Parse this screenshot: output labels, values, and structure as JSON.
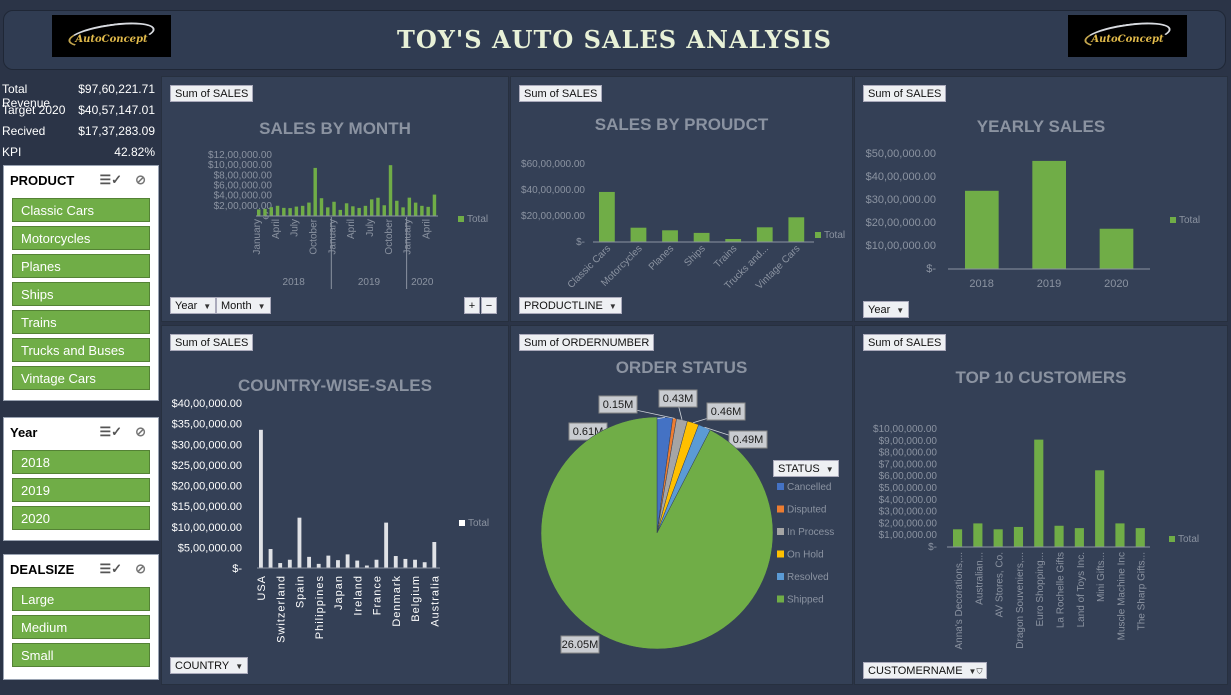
{
  "header": {
    "title": "TOY'S AUTO SALES ANALYSIS",
    "logo_text": "AutoConcept"
  },
  "kpis": [
    {
      "label": "Total Revenue",
      "value": "$97,60,221.71"
    },
    {
      "label": "Target 2020",
      "value": "$40,57,147.01"
    },
    {
      "label": "Recived",
      "value": "$17,37,283.09"
    },
    {
      "label": "KPI",
      "value": "42.82%"
    }
  ],
  "slicers": {
    "product": {
      "title": "PRODUCT",
      "items": [
        "Classic Cars",
        "Motorcycles",
        "Planes",
        "Ships",
        "Trains",
        "Trucks and Buses",
        "Vintage Cars"
      ]
    },
    "year": {
      "title": "Year",
      "items": [
        "2018",
        "2019",
        "2020"
      ]
    },
    "dealsize": {
      "title": "DEALSIZE",
      "items": [
        "Large",
        "Medium",
        "Small"
      ]
    }
  },
  "panels": {
    "month": {
      "value_field": "Sum of SALES",
      "title": "SALES BY MONTH",
      "year_button": "Year",
      "month_button": "Month"
    },
    "product": {
      "value_field": "Sum of SALES",
      "title": "SALES BY PROUDCT",
      "field_button": "PRODUCTLINE"
    },
    "yearly": {
      "value_field": "Sum of SALES",
      "title": "YEARLY SALES",
      "field_button": "Year"
    },
    "country": {
      "value_field": "Sum of SALES",
      "title": "COUNTRY-WISE-SALES",
      "field_button": "COUNTRY"
    },
    "status": {
      "value_field": "Sum of ORDERNUMBER",
      "title": "ORDER STATUS",
      "legend_title": "STATUS"
    },
    "customers": {
      "value_field": "Sum of SALES",
      "title": "TOP 10 CUSTOMERS",
      "field_button": "CUSTOMERNAME"
    }
  },
  "chart_data": [
    {
      "type": "bar",
      "title": "SALES BY MONTH",
      "legend": [
        "Total"
      ],
      "yticks": [
        "$-",
        "$2,00,000.00",
        "$4,00,000.00",
        "$6,00,000.00",
        "$8,00,000.00",
        "$10,00,000.00",
        "$12,00,000.00"
      ],
      "ylim": [
        0,
        1200000
      ],
      "month_labels": [
        "January",
        "April",
        "July",
        "October",
        "January",
        "April",
        "July",
        "October",
        "January",
        "April"
      ],
      "year_groups": [
        {
          "label": "2018",
          "months": 12
        },
        {
          "label": "2019",
          "months": 12
        },
        {
          "label": "2020",
          "months": 5
        }
      ],
      "series": [
        {
          "name": "Total",
          "values": [
            129000,
            140000,
            174000,
            201000,
            160000,
            155000,
            185000,
            200000,
            264000,
            946000,
            350000,
            170000,
            280000,
            120000,
            250000,
            191000,
            159000,
            200000,
            327000,
            359000,
            211000,
            1000000,
            300000,
            170000,
            361000,
            263000,
            200000,
            180000,
            421000
          ]
        }
      ],
      "color": "#70ad47"
    },
    {
      "type": "bar",
      "title": "SALES BY PROUDCT",
      "legend": [
        "Total"
      ],
      "yticks": [
        "$-",
        "$20,00,000.00",
        "$40,00,000.00",
        "$60,00,000.00"
      ],
      "ylim": [
        0,
        6000000
      ],
      "categories": [
        "Classic Cars",
        "Motorcycles",
        "Planes",
        "Ships",
        "Trains",
        "Trucks and...",
        "Vintage Cars"
      ],
      "values": [
        3850000,
        1100000,
        900000,
        700000,
        230000,
        1130000,
        1900000
      ],
      "color": "#70ad47"
    },
    {
      "type": "bar",
      "title": "YEARLY SALES",
      "legend": [
        "Total"
      ],
      "yticks": [
        "$-",
        "$10,00,000.00",
        "$20,00,000.00",
        "$30,00,000.00",
        "$40,00,000.00",
        "$50,00,000.00"
      ],
      "ylim": [
        0,
        5000000
      ],
      "categories": [
        "2018",
        "2019",
        "2020"
      ],
      "values": [
        3400000,
        4700000,
        1750000
      ],
      "color": "#70ad47"
    },
    {
      "type": "bar",
      "title": "COUNTRY-WISE-SALES",
      "legend": [
        "Total"
      ],
      "yticks": [
        "$-",
        "$5,00,000.00",
        "$10,00,000.00",
        "$15,00,000.00",
        "$20,00,000.00",
        "$25,00,000.00",
        "$30,00,000.00",
        "$35,00,000.00",
        "$40,00,000.00"
      ],
      "ylim": [
        0,
        4000000
      ],
      "categories": [
        "USA",
        "",
        "Switzerland",
        "",
        "Spain",
        "",
        "Philippines",
        "",
        "Japan",
        "",
        "Ireland",
        "",
        "France",
        "",
        "Denmark",
        "",
        "Belgium",
        "",
        "Australia"
      ],
      "values": [
        3350000,
        460000,
        120000,
        200000,
        1220000,
        270000,
        100000,
        300000,
        190000,
        330000,
        180000,
        60000,
        200000,
        1100000,
        290000,
        220000,
        200000,
        140000,
        630000
      ],
      "color": "#ffffff"
    },
    {
      "type": "pie",
      "title": "ORDER STATUS",
      "legend_title": "STATUS",
      "slices": [
        {
          "label": "Cancelled",
          "value": 0.61,
          "display": "0.61M",
          "color": "#4472c4"
        },
        {
          "label": "Disputed",
          "value": 0.15,
          "display": "0.15M",
          "color": "#ed7d31"
        },
        {
          "label": "In Process",
          "value": 0.43,
          "display": "0.43M",
          "color": "#a5a5a5"
        },
        {
          "label": "On Hold",
          "value": 0.46,
          "display": "0.46M",
          "color": "#ffc000"
        },
        {
          "label": "Resolved",
          "value": 0.49,
          "display": "0.49M",
          "color": "#5b9bd5"
        },
        {
          "label": "Shipped",
          "value": 26.05,
          "display": "26.05M",
          "color": "#70ad47"
        }
      ]
    },
    {
      "type": "bar",
      "title": "TOP 10 CUSTOMERS",
      "legend": [
        "Total"
      ],
      "yticks": [
        "$-",
        "$1,00,000.00",
        "$2,00,000.00",
        "$3,00,000.00",
        "$4,00,000.00",
        "$5,00,000.00",
        "$6,00,000.00",
        "$7,00,000.00",
        "$8,00,000.00",
        "$9,00,000.00",
        "$10,00,000.00"
      ],
      "ylim": [
        0,
        1000000
      ],
      "categories": [
        "Anna's Decorations,...",
        "Australian...",
        "AV Stores, Co.",
        "Dragon Souveniers,...",
        "Euro Shopping...",
        "La Rochelle Gifts",
        "Land of Toys Inc.",
        "Mini Gifts...",
        "Muscle Machine Inc",
        "The Sharp Gifts..."
      ],
      "values": [
        150000,
        200000,
        150000,
        170000,
        910000,
        180000,
        160000,
        650000,
        200000,
        160000
      ],
      "color": "#70ad47"
    }
  ]
}
